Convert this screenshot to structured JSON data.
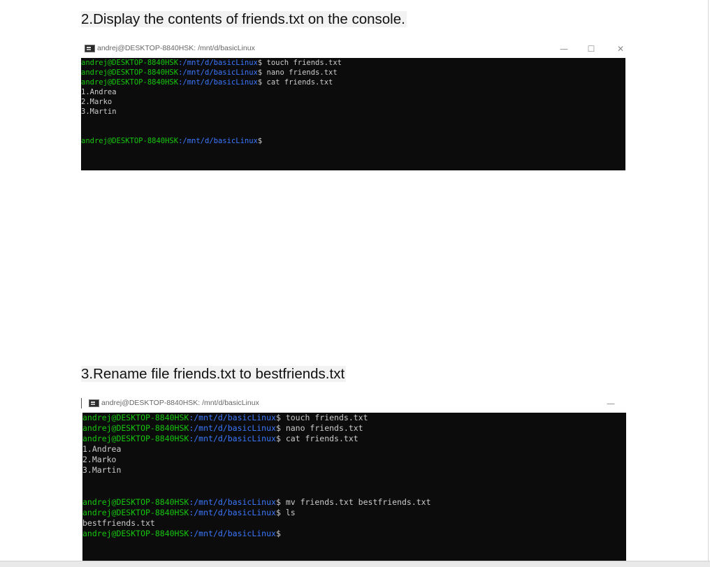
{
  "section2": {
    "heading": "2.Display the contents of friends.txt on the console."
  },
  "section3": {
    "heading": "3.Rename file friends.txt to bestfriends.txt"
  },
  "window1": {
    "title": "andrej@DESKTOP-8840HSK: /mnt/d/basicLinux",
    "icon": "terminal-icon",
    "controls": {
      "minimize": "—",
      "maximize": "☐",
      "close": "✕"
    },
    "prompt": {
      "user_host": "andrej@DESKTOP-8840HSK",
      "path": ":/mnt/d/basicLinux",
      "symbol": "$"
    },
    "lines": [
      {
        "type": "prompt",
        "command": " touch friends.txt"
      },
      {
        "type": "prompt",
        "command": " nano friends.txt"
      },
      {
        "type": "prompt",
        "command": " cat friends.txt"
      },
      {
        "type": "output",
        "text": "1.Andrea"
      },
      {
        "type": "output",
        "text": "2.Marko"
      },
      {
        "type": "output",
        "text": "3.Martin"
      },
      {
        "type": "output",
        "text": ""
      },
      {
        "type": "output",
        "text": ""
      },
      {
        "type": "prompt",
        "command": ""
      }
    ]
  },
  "window2": {
    "title": "andrej@DESKTOP-8840HSK: /mnt/d/basicLinux",
    "icon": "terminal-icon",
    "controls": {
      "minimize": "—"
    },
    "prompt": {
      "user_host": "andrej@DESKTOP-8840HSK",
      "path": ":/mnt/d/basicLinux",
      "symbol": "$"
    },
    "lines": [
      {
        "type": "prompt",
        "command": " touch friends.txt"
      },
      {
        "type": "prompt",
        "command": " nano friends.txt"
      },
      {
        "type": "prompt",
        "command": " cat friends.txt"
      },
      {
        "type": "output",
        "text": "1.Andrea"
      },
      {
        "type": "output",
        "text": "2.Marko"
      },
      {
        "type": "output",
        "text": "3.Martin"
      },
      {
        "type": "output",
        "text": ""
      },
      {
        "type": "output",
        "text": ""
      },
      {
        "type": "prompt",
        "command": " mv friends.txt bestfriends.txt"
      },
      {
        "type": "prompt",
        "command": " ls"
      },
      {
        "type": "output",
        "text": "bestfriends.txt"
      },
      {
        "type": "prompt",
        "command": ""
      }
    ]
  }
}
